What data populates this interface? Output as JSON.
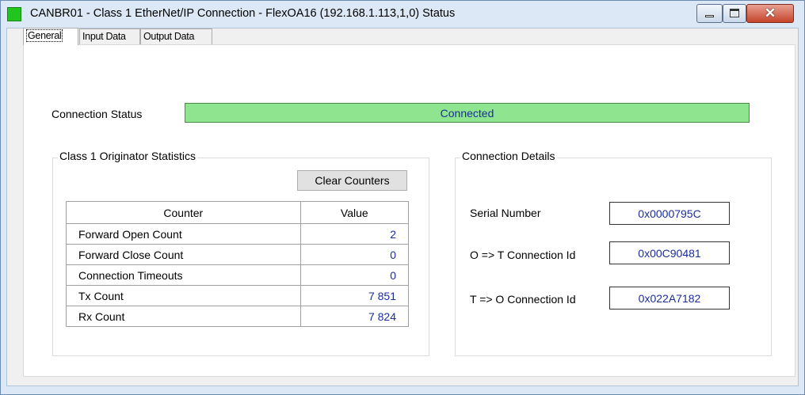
{
  "window": {
    "title": "CANBR01 - Class 1 EtherNet/IP Connection - FlexOA16 (192.168.1.113,1,0) Status",
    "close_glyph": "✕"
  },
  "tabs": [
    {
      "label": "General",
      "active": true
    },
    {
      "label": "Input Data",
      "active": false
    },
    {
      "label": "Output Data",
      "active": false
    }
  ],
  "connection": {
    "label": "Connection Status",
    "status": "Connected",
    "status_color": "#8fe58f"
  },
  "stats": {
    "group_title": "Class 1 Originator Statistics",
    "clear_button": "Clear Counters",
    "headers": [
      "Counter",
      "Value"
    ],
    "rows": [
      {
        "counter": "Forward Open Count",
        "value": "2"
      },
      {
        "counter": "Forward Close Count",
        "value": "0"
      },
      {
        "counter": "Connection Timeouts",
        "value": "0"
      },
      {
        "counter": "Tx Count",
        "value": "7 851"
      },
      {
        "counter": "Rx Count",
        "value": "7 824"
      }
    ]
  },
  "details": {
    "group_title": "Connection Details",
    "items": [
      {
        "label": "Serial Number",
        "value": "0x0000795C"
      },
      {
        "label": "O => T Connection Id",
        "value": "0x00C90481"
      },
      {
        "label": "T => O Connection Id",
        "value": "0x022A7182"
      }
    ]
  },
  "colors": {
    "value_text": "#1a2d99",
    "app_icon": "#22c41e",
    "close_button": "#c5442c"
  }
}
